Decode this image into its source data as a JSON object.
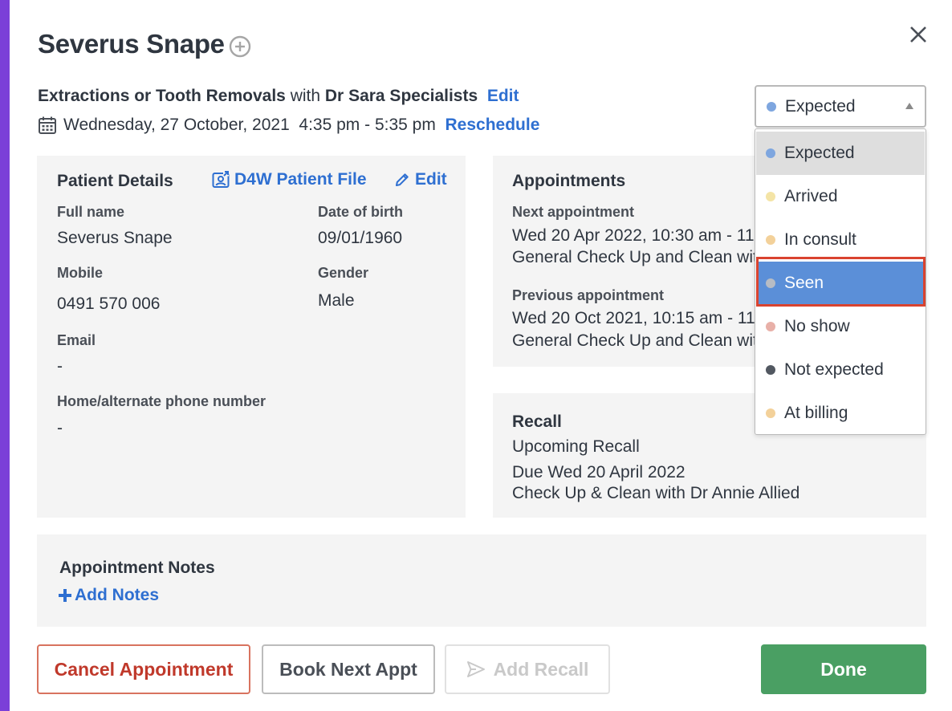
{
  "title": "Severus Snape",
  "appointment": {
    "procedure": "Extractions or Tooth Removals",
    "with_word": "with",
    "provider": "Dr Sara Specialists",
    "edit_label": "Edit",
    "date_time": "Wednesday, 27 October, 2021  4:35 pm - 5:35 pm",
    "reschedule_label": "Reschedule"
  },
  "status": {
    "current": "Expected",
    "current_color": "#7ea6df",
    "options": [
      {
        "label": "Expected",
        "color": "#7ea6df"
      },
      {
        "label": "Arrived",
        "color": "#f4e4a6"
      },
      {
        "label": "In consult",
        "color": "#f3d19a"
      },
      {
        "label": "Seen",
        "color": "#b7bcc4"
      },
      {
        "label": "No show",
        "color": "#e8b0a8"
      },
      {
        "label": "Not expected",
        "color": "#525861"
      },
      {
        "label": "At billing",
        "color": "#f3d19a"
      }
    ]
  },
  "patient": {
    "heading": "Patient Details",
    "file_link": "D4W Patient File",
    "edit_label": "Edit",
    "full_name_label": "Full name",
    "full_name": "Severus Snape",
    "dob_label": "Date of birth",
    "dob": "09/01/1960",
    "mobile_label": "Mobile",
    "mobile": "0491 570 006",
    "gender_label": "Gender",
    "gender": "Male",
    "email_label": "Email",
    "email": "-",
    "alt_phone_label": "Home/alternate phone number",
    "alt_phone": "-"
  },
  "appointments": {
    "heading": "Appointments",
    "next_label": "Next appointment",
    "next_time": "Wed 20 Apr 2022, 10:30 am - 11",
    "next_desc": "General Check Up and Clean with",
    "prev_label": "Previous appointment",
    "prev_time": "Wed 20 Oct 2021, 10:15 am - 11",
    "prev_desc": "General Check Up and Clean with"
  },
  "recall": {
    "heading": "Recall",
    "status": "Upcoming Recall",
    "due": "Due Wed 20 April 2022",
    "desc": "Check Up & Clean with Dr Annie Allied"
  },
  "notes": {
    "heading": "Appointment Notes",
    "add_label": "Add Notes"
  },
  "buttons": {
    "cancel": "Cancel Appointment",
    "book_next": "Book Next Appt",
    "add_recall": "Add Recall",
    "done": "Done"
  }
}
